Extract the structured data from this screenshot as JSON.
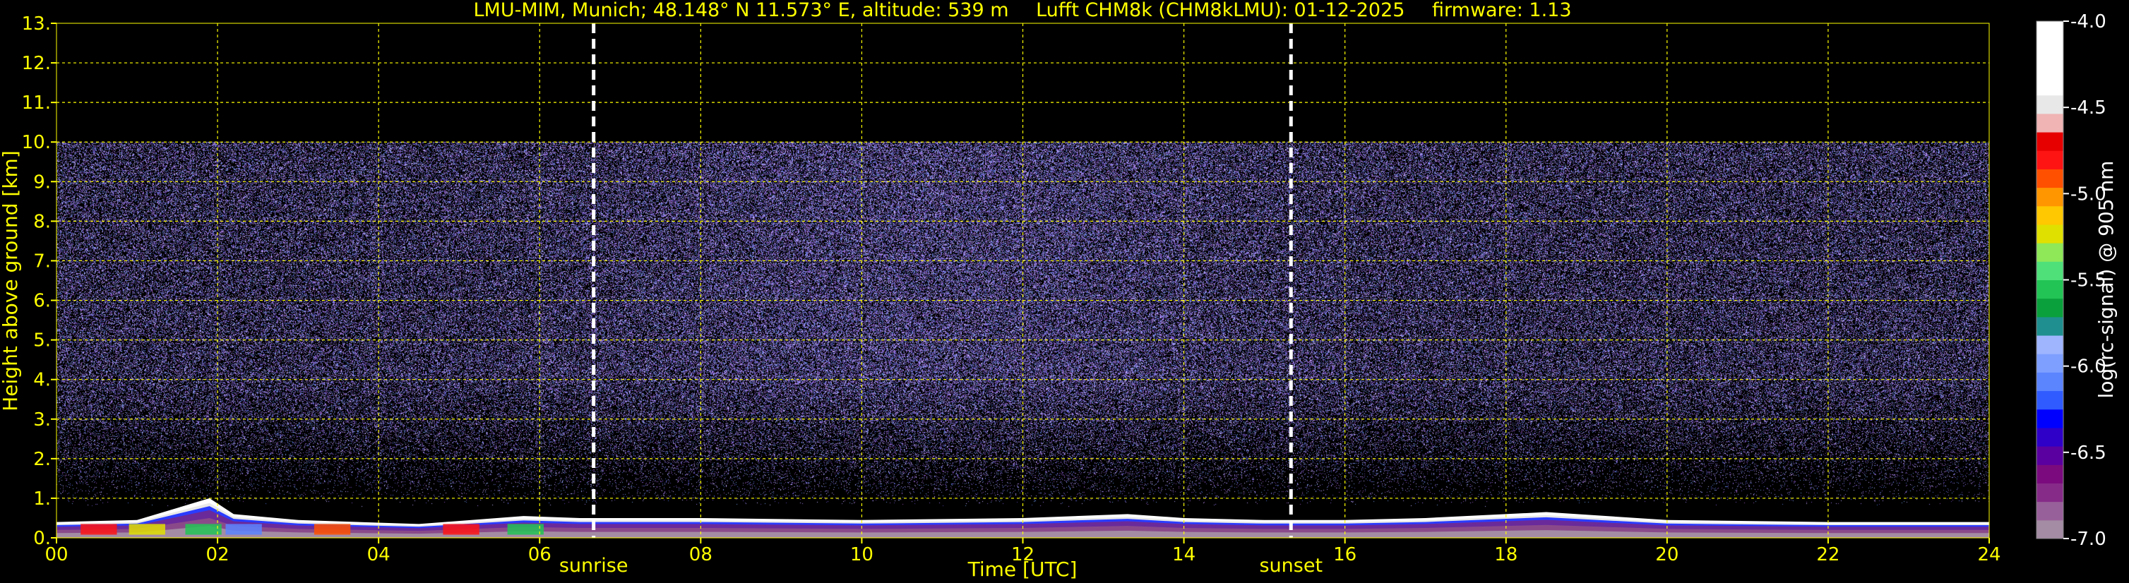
{
  "title": {
    "station": "LMU-MIM, Munich; 48.148° N 11.573° E, altitude: 539 m",
    "instrument": "Lufft CHM8k (CHM8kLMU): 01-12-2025",
    "firmware": "firmware: 1.13"
  },
  "chart_data": {
    "type": "heatmap",
    "title": "LMU-MIM, Munich; 48.148° N 11.573° E, altitude: 539 m    Lufft CHM8k (CHM8kLMU): 01-12-2025    firmware: 1.13",
    "xlabel": "Time [UTC]",
    "ylabel": "Height above ground [km]",
    "xlim": [
      0,
      24
    ],
    "ylim": [
      0,
      13
    ],
    "x_ticks": [
      0,
      2,
      4,
      6,
      8,
      10,
      12,
      14,
      16,
      18,
      20,
      22,
      24
    ],
    "x_tick_labels": [
      "00",
      "02",
      "04",
      "06",
      "08",
      "10",
      "12",
      "14",
      "16",
      "18",
      "20",
      "22",
      "24"
    ],
    "y_ticks": [
      0,
      1,
      2,
      3,
      4,
      5,
      6,
      7,
      8,
      9,
      10,
      11,
      12,
      13
    ],
    "y_tick_labels": [
      "0.",
      "1.",
      "2.",
      "3.",
      "4.",
      "5.",
      "6.",
      "7.",
      "8.",
      "9.",
      "10.",
      "11.",
      "12.",
      "13."
    ],
    "grid": true,
    "data_top_km": 10,
    "noise_fade_height_km": 2,
    "boundary_layer_top_km": [
      [
        0,
        0.4
      ],
      [
        1,
        0.45
      ],
      [
        1.9,
        1.0
      ],
      [
        2.2,
        0.6
      ],
      [
        3,
        0.45
      ],
      [
        4.5,
        0.35
      ],
      [
        5.8,
        0.55
      ],
      [
        6.5,
        0.5
      ],
      [
        7,
        0.5
      ],
      [
        8,
        0.5
      ],
      [
        10,
        0.45
      ],
      [
        12,
        0.5
      ],
      [
        13.3,
        0.6
      ],
      [
        14,
        0.5
      ],
      [
        15,
        0.45
      ],
      [
        16,
        0.45
      ],
      [
        17,
        0.5
      ],
      [
        18.5,
        0.65
      ],
      [
        20,
        0.45
      ],
      [
        22,
        0.4
      ],
      [
        24,
        0.4
      ]
    ],
    "vertical_markers": [
      {
        "x": 6.67,
        "label": "sunrise"
      },
      {
        "x": 15.33,
        "label": "sunset"
      }
    ],
    "colorbar": {
      "label": "log(rc-signal) @ 905 nm",
      "range": [
        -7.0,
        -4.0
      ],
      "ticks": [
        -4.0,
        -4.5,
        -5.0,
        -5.5,
        -6.0,
        -6.5,
        -7.0
      ],
      "tick_labels": [
        "-4.0",
        "-4.5",
        "-5.0",
        "-5.5",
        "-6.0",
        "-6.5",
        "-7.0"
      ],
      "colors": [
        "#a48ca4",
        "#98609a",
        "#862b88",
        "#7a0a7e",
        "#5a00a0",
        "#2e00c8",
        "#0000ff",
        "#2f5bff",
        "#5b84ff",
        "#7e9fff",
        "#9fb6ff",
        "#1f8f8f",
        "#0aa03c",
        "#22c455",
        "#4fe07a",
        "#8ee858",
        "#e0e000",
        "#ffc800",
        "#ff9600",
        "#ff5000",
        "#ff1414",
        "#e60000",
        "#f0b4b4",
        "#e8e8e8",
        "#ffffff",
        "#ffffff",
        "#ffffff",
        "#ffffff"
      ]
    }
  }
}
